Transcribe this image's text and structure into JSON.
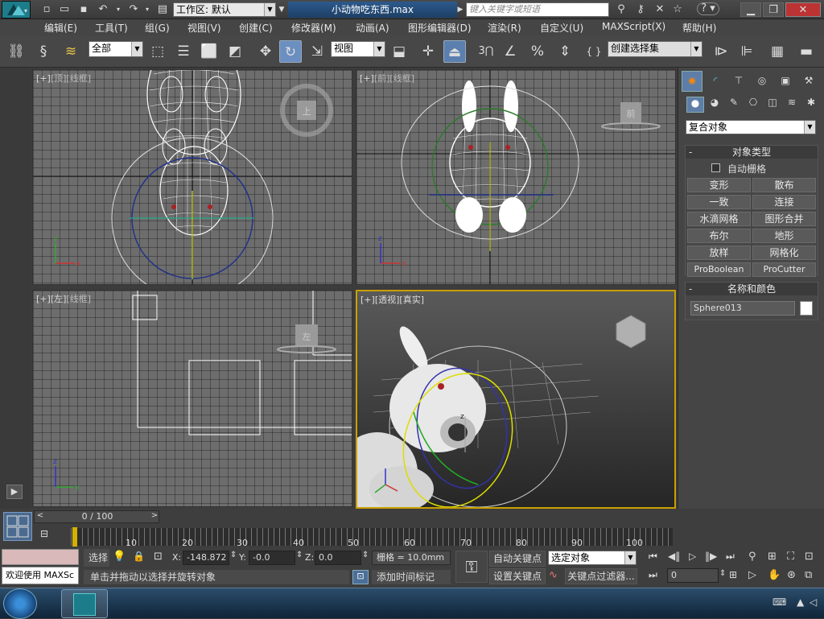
{
  "titlebar": {
    "workspace": "工作区: 默认",
    "filename": "小动物吃东西.max",
    "search_placeholder": "键入关键字或短语"
  },
  "menu": [
    "编辑(E)",
    "工具(T)",
    "组(G)",
    "视图(V)",
    "创建(C)",
    "修改器(M)",
    "动画(A)",
    "图形编辑器(D)",
    "渲染(R)",
    "自定义(U)",
    "MAXScript(X)",
    "帮助(H)"
  ],
  "toolbar": {
    "selection_filter": "全部",
    "ref_coord": "视图",
    "snap_label": "3",
    "named_selection": "创建选择集"
  },
  "viewports": {
    "top": {
      "labels": [
        "[+]",
        "[顶]",
        "[线框]"
      ],
      "cube": "上"
    },
    "front": {
      "labels": [
        "[+]",
        "[前]",
        "[线框]"
      ],
      "cube": "前"
    },
    "left": {
      "labels": [
        "[+]",
        "[左]",
        "[线框]"
      ],
      "cube": "左"
    },
    "persp": {
      "labels": [
        "[+]",
        "[透视]",
        "[真实]"
      ]
    }
  },
  "axis_labels": {
    "x": "x",
    "y": "y",
    "z": "z"
  },
  "command_panel": {
    "dropdown": "复合对象",
    "object_type": {
      "title": "对象类型",
      "autogrid": "自动栅格",
      "buttons": [
        "变形",
        "散布",
        "一致",
        "连接",
        "水滴网格",
        "图形合并",
        "布尔",
        "地形",
        "放样",
        "网格化",
        "ProBoolean",
        "ProCutter"
      ]
    },
    "name_color": {
      "title": "名称和颜色",
      "name": "Sphere013",
      "color": "#ffffff"
    }
  },
  "timeline": {
    "slider": "0 / 100",
    "ticks": [
      "10",
      "20",
      "30",
      "40",
      "50",
      "60",
      "70",
      "80",
      "90",
      "100"
    ]
  },
  "status": {
    "welcome": "欢迎使用 MAXSc",
    "select_label": "选择",
    "prompt": "单击并拖动以选择并旋转对象",
    "x_label": "X:",
    "x_value": "-148.872",
    "y_label": "Y:",
    "y_value": "-0.0",
    "z_label": "Z:",
    "z_value": "0.0",
    "grid": "栅格 = 10.0mm",
    "add_time_tag": "添加时间标记",
    "auto_key": "自动关键点",
    "set_key": "设置关键点",
    "key_filter_select": "选定对象",
    "key_filters": "关键点过滤器...",
    "frame": "0"
  },
  "colors": {
    "accent": "#6a8fc0",
    "active_viewport_border": "#c8a000"
  }
}
